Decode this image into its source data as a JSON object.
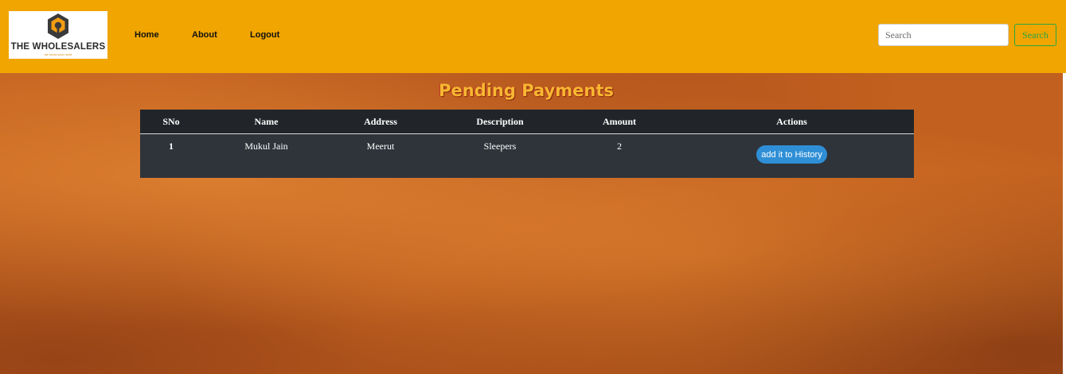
{
  "brand": {
    "name": "THE WHOLESALERS",
    "tagline": "we know your need",
    "icon": "brand-logo-icon"
  },
  "nav": {
    "links": [
      "Home",
      "About",
      "Logout"
    ]
  },
  "search": {
    "placeholder": "Search",
    "button_label": "Search"
  },
  "page": {
    "title": "Pending Payments"
  },
  "table": {
    "headers": [
      "SNo",
      "Name",
      "Address",
      "Description",
      "Amount",
      "Actions"
    ],
    "rows": [
      {
        "sno": "1",
        "name": "Mukul Jain",
        "address": "Meerut",
        "description": "Sleepers",
        "amount": "2",
        "action_label": "add it to History"
      }
    ]
  },
  "colors": {
    "navbar": "#f0a500",
    "table_header": "#212529",
    "action_button": "#2f8fd6",
    "search_button": "#28a745",
    "title": "#f7b731"
  }
}
